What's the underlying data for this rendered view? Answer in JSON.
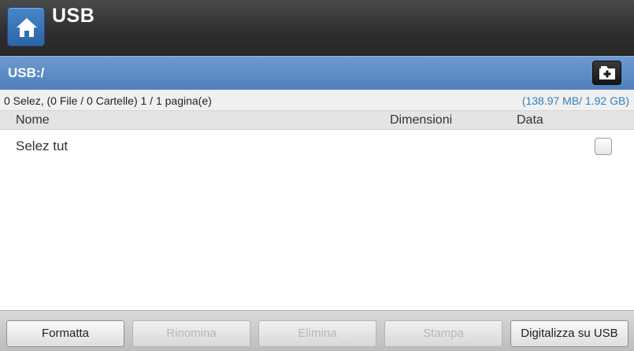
{
  "header": {
    "title": "USB",
    "home_icon": "home-icon"
  },
  "path_bar": {
    "path": "USB:/",
    "new_folder_icon": "new-folder-icon"
  },
  "info": {
    "selection": "0 Selez, (0 File / 0 Cartelle) 1 / 1 pagina(e)",
    "space": "(138.97 MB/ 1.92 GB)"
  },
  "columns": {
    "name": "Nome",
    "size": "Dimensioni",
    "date": "Data"
  },
  "list": {
    "select_all_label": "Selez tut",
    "select_all_checked": false
  },
  "footer": {
    "buttons": [
      {
        "label": "Formatta",
        "enabled": true
      },
      {
        "label": "Rinomina",
        "enabled": false
      },
      {
        "label": "Elimina",
        "enabled": false
      },
      {
        "label": "Stampa",
        "enabled": false
      },
      {
        "label": "Digitalizza su USB",
        "enabled": true
      }
    ]
  },
  "colors": {
    "accent": "#2f7fc1",
    "path_bar": "#5a8ac6",
    "header": "#333333"
  }
}
